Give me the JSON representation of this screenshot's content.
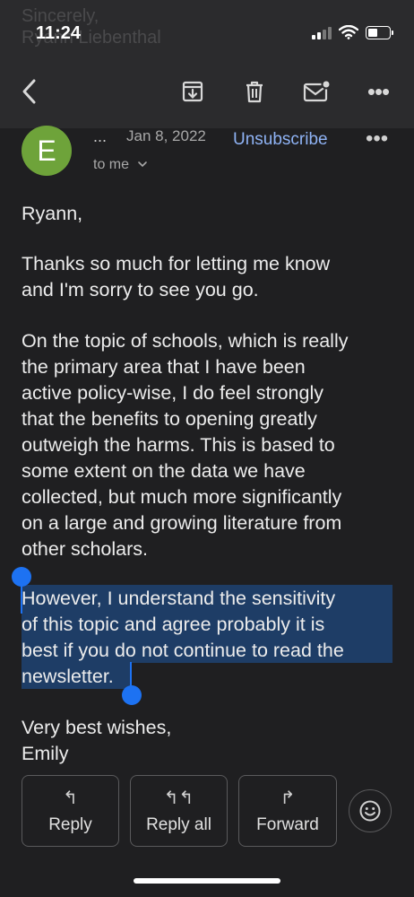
{
  "status_bar": {
    "time": "11:24"
  },
  "background_ghost": {
    "line1": "Sincerely,",
    "line2": "Ryann Liebenthal"
  },
  "toolbar": {
    "back_icon": "chevron-left-icon",
    "archive_icon": "archive-icon",
    "delete_icon": "trash-icon",
    "mark_unread_icon": "mail-unread-icon",
    "more_icon": "more-dots-icon",
    "more_glyph": "•••"
  },
  "message_header": {
    "avatar_letter": "E",
    "avatar_color": "#6ea33a",
    "sender_truncated": "...",
    "date": "Jan 8, 2022",
    "unsubscribe_label": "Unsubscribe",
    "recipient_label": "to me",
    "more_glyph": "•••"
  },
  "body": {
    "greeting": "Ryann,",
    "p1_l1": "Thanks so much for letting me know",
    "p1_l2": "and I'm sorry to see you go.",
    "p2_l1": "On the topic of schools, which is really",
    "p2_l2": "the primary area that I have been",
    "p2_l3": "active policy-wise, I do feel strongly",
    "p2_l4": "that the benefits to opening greatly",
    "p2_l5": "outweigh the harms.  This is based to",
    "p2_l6": "some extent on the data we have",
    "p2_l7": "collected, but much more significantly",
    "p2_l8": "on a large and growing literature from",
    "p2_l9": "other scholars.",
    "p3_l1": "However, I understand the sensitivity",
    "p3_l2": "of this topic and agree probably it is",
    "p3_l3": "best if you do not continue to read the",
    "p3_l4": "newsletter.",
    "closing": "Very best wishes,",
    "signature": "Emily"
  },
  "selection_color": "#1e3d66",
  "accent_color": "#1d72f2",
  "actions": {
    "reply_label": "Reply",
    "reply_all_label": "Reply all",
    "forward_label": "Forward",
    "reply_glyph": "↰",
    "reply_all_glyph": "↰↰",
    "forward_glyph": "↱",
    "emoji_icon": "smiley-icon"
  }
}
